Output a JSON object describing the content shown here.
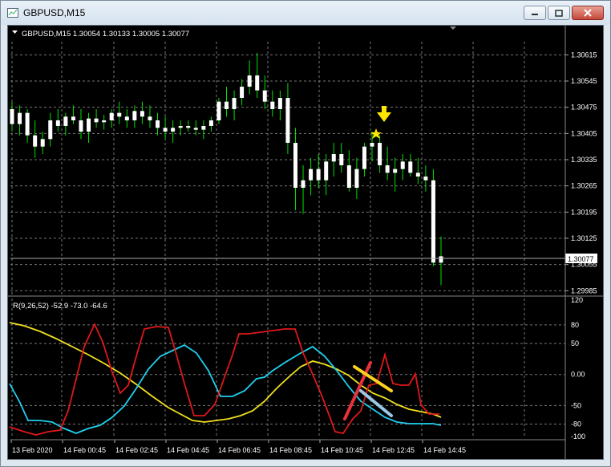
{
  "window": {
    "title": "GBPUSD,M15"
  },
  "main_chart": {
    "header": "GBPUSD,M15  1.30054 1.30133 1.30005 1.30077",
    "price_labels": [
      "1.30615",
      "1.30545",
      "1.30475",
      "1.30405",
      "1.30335",
      "1.30265",
      "1.30195",
      "1.30125",
      "1.30055",
      "1.29985"
    ],
    "current_price": "1.30077",
    "colors": {
      "candle": "#ffffff",
      "wick": "#00e000",
      "grid": "#7a7a7a",
      "marker": "#ffea00"
    }
  },
  "indicator": {
    "header": "R(9,26,52) -52.9 -73.0 -64.6",
    "levels": [
      "120",
      "80",
      "50",
      "0.00",
      "-50",
      "-80",
      "-100"
    ],
    "colors": {
      "fast": "#e01818",
      "mid": "#20d0f0",
      "slow": "#f0e020"
    }
  },
  "time_labels": [
    "13 Feb 2020",
    "14 Feb 00:45",
    "14 Feb 02:45",
    "14 Feb 04:45",
    "14 Feb 06:45",
    "14 Feb 08:45",
    "14 Feb 10:45",
    "14 Feb 12:45",
    "14 Feb 14:45"
  ],
  "chart_data": {
    "type": "candlestick",
    "x_interval": "M15",
    "candles": [
      [
        1.3047,
        1.3049,
        1.3041,
        1.3043
      ],
      [
        1.3043,
        1.3048,
        1.304,
        1.3046
      ],
      [
        1.3046,
        1.3047,
        1.3038,
        1.304
      ],
      [
        1.304,
        1.3044,
        1.3034,
        1.3037
      ],
      [
        1.3037,
        1.3041,
        1.3035,
        1.3039
      ],
      [
        1.3039,
        1.3046,
        1.3037,
        1.3044
      ],
      [
        1.3044,
        1.3047,
        1.3041,
        1.30425
      ],
      [
        1.30425,
        1.3046,
        1.304,
        1.3045
      ],
      [
        1.3045,
        1.3048,
        1.3043,
        1.3044
      ],
      [
        1.3044,
        1.3047,
        1.3039,
        1.3041
      ],
      [
        1.3041,
        1.3046,
        1.3038,
        1.30445
      ],
      [
        1.30445,
        1.3047,
        1.3042,
        1.30435
      ],
      [
        1.30435,
        1.30455,
        1.30415,
        1.3044
      ],
      [
        1.3044,
        1.3047,
        1.3042,
        1.3046
      ],
      [
        1.3046,
        1.3049,
        1.3043,
        1.3045
      ],
      [
        1.3045,
        1.3047,
        1.3042,
        1.3044
      ],
      [
        1.3044,
        1.3048,
        1.3042,
        1.30465
      ],
      [
        1.30465,
        1.3049,
        1.3043,
        1.3045
      ],
      [
        1.3045,
        1.3048,
        1.3042,
        1.3044
      ],
      [
        1.3044,
        1.3046,
        1.304,
        1.3042
      ],
      [
        1.3042,
        1.3045,
        1.3039,
        1.3041
      ],
      [
        1.3041,
        1.3044,
        1.3038,
        1.3042
      ],
      [
        1.3042,
        1.3044,
        1.304,
        1.30425
      ],
      [
        1.30425,
        1.3044,
        1.3041,
        1.3042
      ],
      [
        1.3042,
        1.3044,
        1.304,
        1.30415
      ],
      [
        1.30415,
        1.3044,
        1.3039,
        1.30425
      ],
      [
        1.30425,
        1.3045,
        1.3041,
        1.3044
      ],
      [
        1.3044,
        1.305,
        1.3043,
        1.3049
      ],
      [
        1.3049,
        1.3053,
        1.3045,
        1.3047
      ],
      [
        1.3047,
        1.3052,
        1.3044,
        1.305
      ],
      [
        1.305,
        1.3055,
        1.3048,
        1.3053
      ],
      [
        1.3053,
        1.306,
        1.3051,
        1.3056
      ],
      [
        1.3056,
        1.3062,
        1.305,
        1.3052
      ],
      [
        1.3052,
        1.3056,
        1.3047,
        1.3049
      ],
      [
        1.3049,
        1.3052,
        1.3045,
        1.3047
      ],
      [
        1.3047,
        1.3052,
        1.3044,
        1.305
      ],
      [
        1.305,
        1.3054,
        1.3035,
        1.3038
      ],
      [
        1.3038,
        1.3042,
        1.302,
        1.3026
      ],
      [
        1.3026,
        1.3032,
        1.3019,
        1.3028
      ],
      [
        1.3028,
        1.3034,
        1.3024,
        1.3031
      ],
      [
        1.3031,
        1.3035,
        1.3026,
        1.3028
      ],
      [
        1.3028,
        1.3035,
        1.3024,
        1.3033
      ],
      [
        1.3033,
        1.3038,
        1.3029,
        1.3035
      ],
      [
        1.3035,
        1.3038,
        1.303,
        1.3032
      ],
      [
        1.3032,
        1.3036,
        1.3025,
        1.3026
      ],
      [
        1.3026,
        1.3034,
        1.3023,
        1.3031
      ],
      [
        1.3031,
        1.3038,
        1.3029,
        1.3037
      ],
      [
        1.3037,
        1.3041,
        1.3033,
        1.3038
      ],
      [
        1.3038,
        1.304,
        1.303,
        1.3032
      ],
      [
        1.3032,
        1.3037,
        1.3028,
        1.303
      ],
      [
        1.303,
        1.3034,
        1.3025,
        1.3031
      ],
      [
        1.3031,
        1.3035,
        1.3028,
        1.3033
      ],
      [
        1.3033,
        1.3035,
        1.3029,
        1.303
      ],
      [
        1.303,
        1.3034,
        1.3027,
        1.3029
      ],
      [
        1.3029,
        1.3032,
        1.3025,
        1.3028
      ],
      [
        1.3028,
        1.3031,
        1.3005,
        1.3006
      ],
      [
        1.3006,
        1.3013,
        1.3,
        1.30077
      ]
    ],
    "ylim": [
      1.29985,
      1.3065
    ]
  }
}
